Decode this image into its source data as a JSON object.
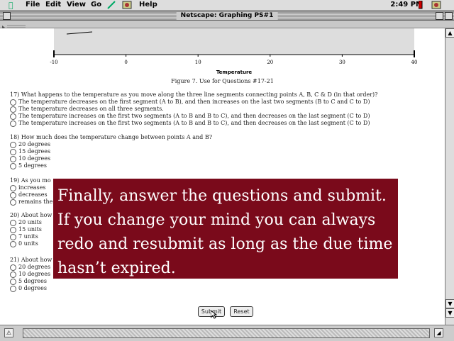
{
  "menubar": {
    "items": [
      "File",
      "Edit",
      "View",
      "Go",
      "Help"
    ],
    "clock": "2:49 PM"
  },
  "window": {
    "title": "Netscape: Graphing  PS#1"
  },
  "chart_data": {
    "type": "line",
    "xlabel": "Temperature",
    "x_ticks": [
      "-10",
      "0",
      "10",
      "20",
      "30",
      "40"
    ],
    "xlim": [
      -10,
      40
    ]
  },
  "figure_caption": "Figure 7. Use for Questions #17-21",
  "questions": [
    {
      "text": "17) What happens to the temperature as you move along the three line segments connecting points A, B, C & D (in that order)?",
      "options": [
        "The temperature decreases on the first segment (A to B), and then increases on the last two segments (B to C and C to D)",
        "The temperature decreases on all three segments.",
        "The temperature increases on the first two segments (A to B and B to C), and then decreases on the last segment (C to D)",
        "The temperature increases on the first two segments (A to B and B to C), and then decreases on the last segment (C to D)"
      ]
    },
    {
      "text": "18) How much does the temperature change between points A and B?",
      "options": [
        "20 degrees",
        "15 degrees",
        "10 degrees",
        "5 degrees"
      ]
    },
    {
      "text": "19) As you mo",
      "options": [
        "increases",
        "decreases",
        "remains the"
      ]
    },
    {
      "text": "20) About how",
      "options": [
        "20 units",
        "15 units",
        "7 units",
        "0 units"
      ]
    },
    {
      "text": "21) About how",
      "options": [
        "20 degrees",
        "10 degrees",
        "5 degrees",
        "0 degrees"
      ]
    }
  ],
  "buttons": {
    "submit": "Submit",
    "reset": "Reset"
  },
  "overlay": {
    "lines": [
      "Finally, answer the questions and submit.",
      "If you change your mind you can always",
      "redo and resubmit as long as the due time",
      "hasn’t expired."
    ]
  }
}
